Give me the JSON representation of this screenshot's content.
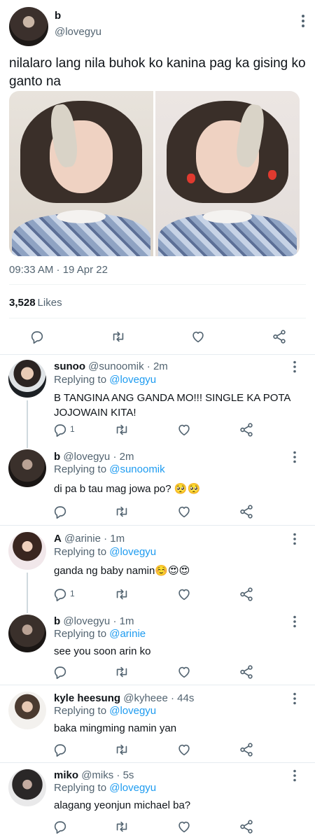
{
  "tweet": {
    "name": "b",
    "handle": "@lovegyu",
    "text": "nilalaro lang nila buhok ko kanina pag ka gising ko ganto na",
    "timestamp": "09:33 AM · 19 Apr 22",
    "likes_count": "3,528",
    "likes_label": "Likes"
  },
  "replies": [
    {
      "name": "sunoo",
      "handle": "@sunoomik",
      "time": "· 2m",
      "replying_prefix": "Replying to",
      "replying_to": "@lovegyu",
      "text": "B TANGINA ANG GANDA MO!!! SINGLE KA POTA JOJOWAIN KITA!",
      "reply_count": "1"
    },
    {
      "name": "b",
      "handle": "@lovegyu",
      "time": "· 2m",
      "replying_prefix": "Replying to",
      "replying_to": "@sunoomik",
      "text": "di pa b tau mag jowa po? 🥺🥺",
      "reply_count": ""
    },
    {
      "name": "A",
      "handle": "@arinie",
      "time": "· 1m",
      "replying_prefix": "Replying to",
      "replying_to": "@lovegyu",
      "text": "ganda ng baby namin☺️😍😍",
      "reply_count": "1"
    },
    {
      "name": "b",
      "handle": "@lovegyu",
      "time": "· 1m",
      "replying_prefix": "Replying to",
      "replying_to": "@arinie",
      "text": "see you soon arin ko",
      "reply_count": ""
    },
    {
      "name": "kyle heesung",
      "handle": "@kyheee",
      "time": "· 44s",
      "replying_prefix": "Replying to",
      "replying_to": "@lovegyu",
      "text": "baka mingming namin yan",
      "reply_count": ""
    },
    {
      "name": "miko",
      "handle": "@miks",
      "time": "· 5s",
      "replying_prefix": "Replying to",
      "replying_to": "@lovegyu",
      "text": "alagang yeonjun michael ba?",
      "reply_count": ""
    }
  ]
}
